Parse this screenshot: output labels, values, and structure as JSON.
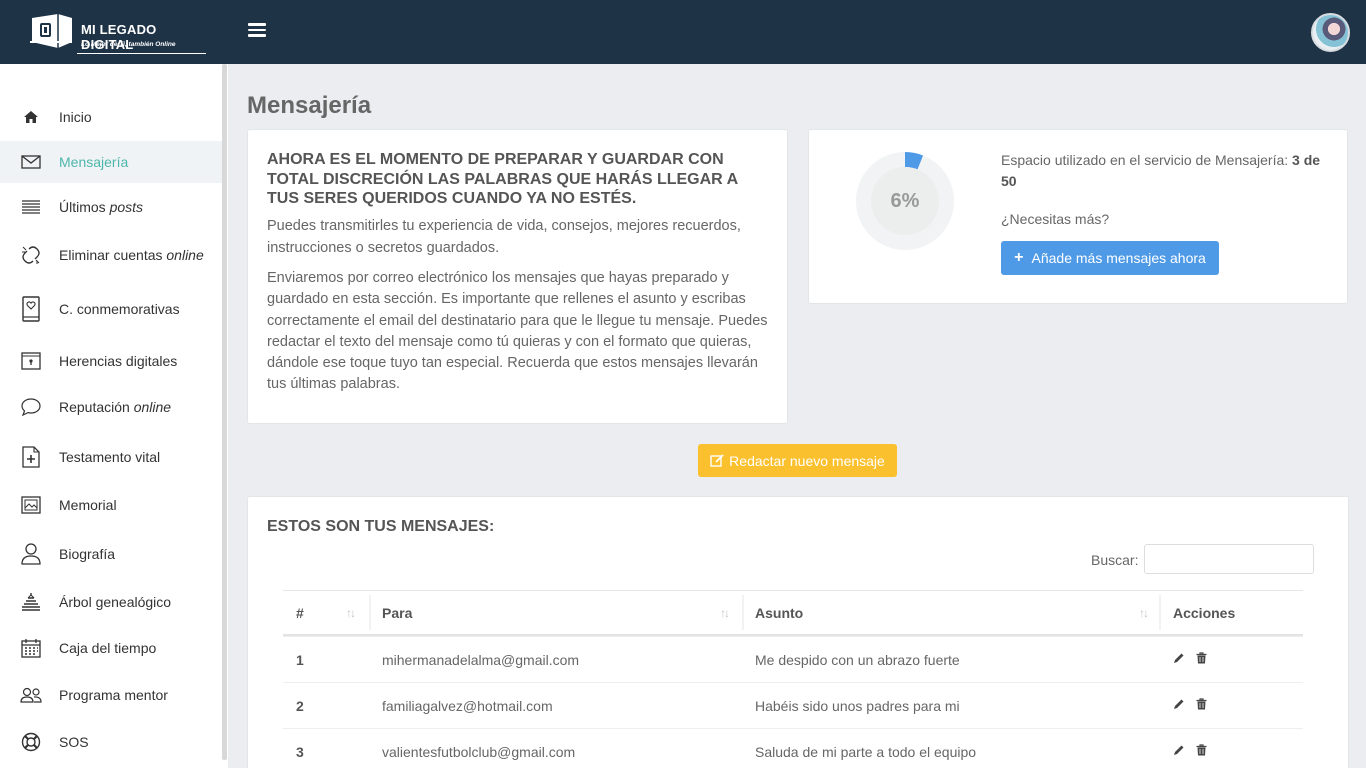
{
  "brand": {
    "title": "MI LEGADO DIGITAL",
    "tagline": "Lo Mejor de Ti, también Online"
  },
  "sidebar": {
    "items": [
      {
        "label": "Inicio",
        "icon": "home-icon"
      },
      {
        "label": "Mensajería",
        "icon": "envelope-icon",
        "active": true
      },
      {
        "label": "Últimos ",
        "label_em": "posts",
        "icon": "list-icon"
      },
      {
        "label": "Eliminar cuentas ",
        "label_em": "online",
        "icon": "broken-link-icon"
      },
      {
        "label": "C. conmemorativas",
        "icon": "book-heart-icon"
      },
      {
        "label": "Herencias digitales",
        "icon": "safe-box-icon"
      },
      {
        "label": "Reputación ",
        "label_em": "online",
        "icon": "speech-bubble-icon"
      },
      {
        "label": "Testamento vital",
        "icon": "document-plus-icon"
      },
      {
        "label": "Memorial",
        "icon": "picture-frame-icon"
      },
      {
        "label": "Biografía",
        "icon": "person-icon"
      },
      {
        "label": "Árbol genealógico",
        "icon": "tree-icon"
      },
      {
        "label": "Caja del tiempo",
        "icon": "calendar-icon"
      },
      {
        "label": "Programa mentor",
        "icon": "people-icon"
      },
      {
        "label": "SOS",
        "icon": "lifebuoy-icon"
      }
    ]
  },
  "page": {
    "title": "Mensajería"
  },
  "info": {
    "heading": "AHORA ES EL MOMENTO DE PREPARAR Y GUARDAR CON TOTAL DISCRECIÓN LAS PALABRAS QUE HARÁS LLEGAR A TUS SERES QUERIDOS CUANDO YA NO ESTÉS.",
    "p1": "Puedes transmitirles tu experiencia de vida, consejos, mejores recuerdos, instrucciones o secretos guardados.",
    "p2": "Enviaremos por correo electrónico los mensajes que hayas preparado y guardado en esta sección. Es importante que rellenes el asunto y escribas correctamente el email del destinatario para que le llegue tu mensaje. Puedes redactar el texto del mensaje como tú quieras y con el formato que quieras, dándole ese toque tuyo tan especial. Recuerda que estos mensajes llevarán tus últimas palabras."
  },
  "usage": {
    "percent_label": "6%",
    "percent": 0.06,
    "text": "Espacio utilizado en el servicio de Mensajería: ",
    "count": "3 de 50",
    "need_more": "¿Necesitas más?",
    "button": "Añade más mensajes ahora",
    "accent": "#4e9ae6"
  },
  "compose_button": "Redactar nuevo mensaje",
  "messages": {
    "heading": "ESTOS SON TUS MENSAJES:",
    "search_label": "Buscar:",
    "search_value": "",
    "columns": [
      "#",
      "Para",
      "Asunto",
      "Acciones"
    ],
    "rows": [
      {
        "n": "1",
        "to": "mihermanadelalma@gmail.com",
        "subject": "Me despido con un abrazo fuerte"
      },
      {
        "n": "2",
        "to": "familiagalvez@hotmail.com",
        "subject": "Habéis sido unos padres para mi"
      },
      {
        "n": "3",
        "to": "valientesfutbolclub@gmail.com",
        "subject": "Saluda de mi parte a todo el equipo"
      }
    ]
  },
  "colors": {
    "topbar": "#1f3347",
    "active": "#4db6ac",
    "warning": "#fbc02d"
  }
}
